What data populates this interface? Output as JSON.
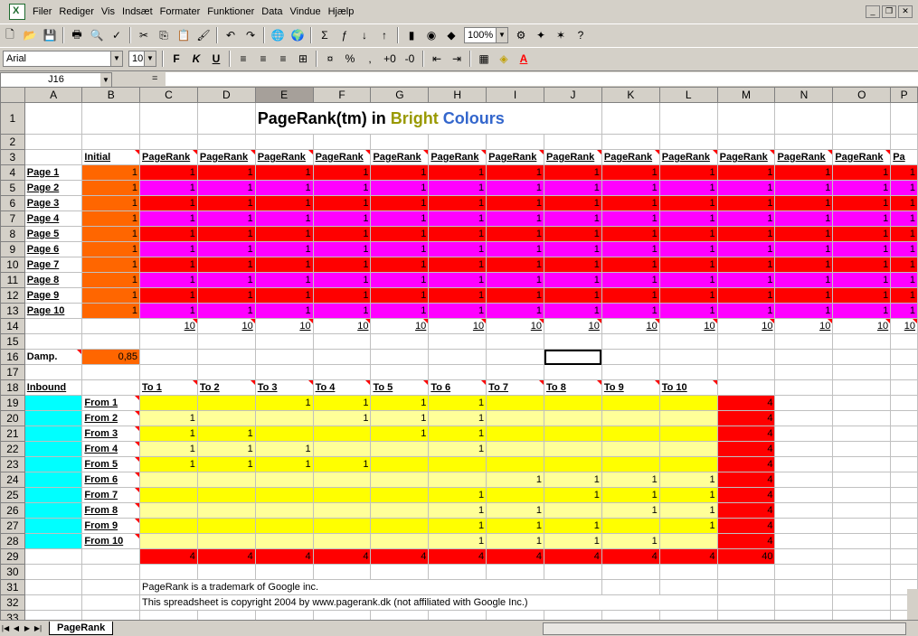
{
  "menu": [
    "Filer",
    "Rediger",
    "Vis",
    "Indsæt",
    "Formater",
    "Funktioner",
    "Data",
    "Vindue",
    "Hjælp"
  ],
  "toolbar": {
    "zoom": "100%",
    "font": "Arial",
    "size": "10"
  },
  "formula_bar": {
    "cell_ref": "J16",
    "equals": "=",
    "content": ""
  },
  "columns": [
    "A",
    "B",
    "C",
    "D",
    "E",
    "F",
    "G",
    "H",
    "I",
    "J",
    "K",
    "L",
    "M",
    "N",
    "O",
    "P"
  ],
  "selected_column": "E",
  "rows": [
    "1",
    "2",
    "3",
    "4",
    "5",
    "6",
    "7",
    "8",
    "9",
    "10",
    "11",
    "12",
    "13",
    "14",
    "15",
    "16",
    "17",
    "18",
    "19",
    "20",
    "21",
    "22",
    "23",
    "24",
    "25",
    "26",
    "27",
    "28",
    "29",
    "30",
    "31",
    "32",
    "33"
  ],
  "title": {
    "part1": "PageRank(tm) in ",
    "part2": "Bright",
    "part3": " Colours",
    "color2": "#999900",
    "color3": "#3366cc"
  },
  "header_row": {
    "initial": "Initial",
    "pagerank": "PageRank",
    "pagerank_partial": "Pa"
  },
  "pages": [
    "Page 1",
    "Page 2",
    "Page 3",
    "Page 4",
    "Page 5",
    "Page 6",
    "Page 7",
    "Page 8",
    "Page 9",
    "Page 10"
  ],
  "initial_value": "1",
  "sum_value": "10",
  "damp_label": "Damp.",
  "damp_value": "0,85",
  "inbound_label": "Inbound",
  "to_labels": [
    "To 1",
    "To 2",
    "To 3",
    "To 4",
    "To 5",
    "To 6",
    "To 7",
    "To 8",
    "To 9",
    "To 10"
  ],
  "from_labels": [
    "From 1",
    "From 2",
    "From 3",
    "From 4",
    "From 5",
    "From 6",
    "From 7",
    "From 8",
    "From 9",
    "From 10"
  ],
  "link_matrix": [
    [
      "",
      "",
      "1",
      "1",
      "1",
      "1",
      "",
      "",
      "",
      ""
    ],
    [
      "1",
      "",
      "",
      "1",
      "1",
      "1",
      "",
      "",
      "",
      ""
    ],
    [
      "1",
      "1",
      "",
      "",
      "1",
      "1",
      "",
      "",
      "",
      ""
    ],
    [
      "1",
      "1",
      "1",
      "",
      "",
      "1",
      "",
      "",
      "",
      ""
    ],
    [
      "1",
      "1",
      "1",
      "1",
      "",
      "",
      "",
      "",
      "",
      ""
    ],
    [
      "",
      "",
      "",
      "",
      "",
      "",
      "1",
      "1",
      "1",
      "1"
    ],
    [
      "",
      "",
      "",
      "",
      "",
      "1",
      "",
      "1",
      "1",
      "1"
    ],
    [
      "",
      "",
      "",
      "",
      "",
      "1",
      "1",
      "",
      "1",
      "1"
    ],
    [
      "",
      "",
      "",
      "",
      "",
      "1",
      "1",
      "1",
      "",
      "1"
    ],
    [
      "",
      "",
      "",
      "",
      "",
      "1",
      "1",
      "1",
      "1",
      ""
    ]
  ],
  "row_totals": [
    "4",
    "4",
    "4",
    "4",
    "4",
    "4",
    "4",
    "4",
    "4",
    "4"
  ],
  "col_totals": [
    "4",
    "4",
    "4",
    "4",
    "4",
    "4",
    "4",
    "4",
    "4",
    "4"
  ],
  "grand_total": "40",
  "footer": {
    "line1": "PageRank is a trademark of Google inc.",
    "line2": "This spreadsheet is copyright 2004 by www.pagerank.dk (not affiliated with Google Inc.)"
  },
  "sheet_tab": "PageRank"
}
